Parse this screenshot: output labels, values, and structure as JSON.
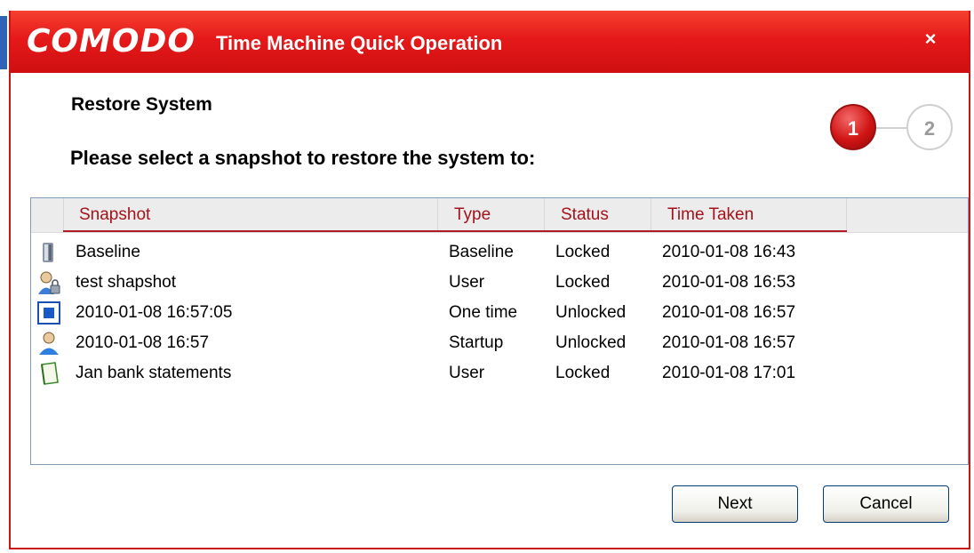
{
  "window": {
    "brand": "COMODO",
    "title": "Time Machine Quick Operation",
    "close_label": "×"
  },
  "heading": "Restore System",
  "prompt": "Please select a snapshot to restore the system to:",
  "steps": [
    "1",
    "2"
  ],
  "table": {
    "columns": [
      "Snapshot",
      "Type",
      "Status",
      "Time Taken"
    ],
    "rows": [
      {
        "icon": "baseline-icon",
        "snapshot": "Baseline",
        "type": "Baseline",
        "status": "Locked",
        "time": "2010-01-08 16:43"
      },
      {
        "icon": "user-lock-icon",
        "snapshot": "test shapshot",
        "type": "User",
        "status": "Locked",
        "time": "2010-01-08 16:53"
      },
      {
        "icon": "one-time-icon",
        "snapshot": "2010-01-08 16:57:05",
        "type": "One time",
        "status": "Unlocked",
        "time": "2010-01-08 16:57"
      },
      {
        "icon": "startup-user-icon",
        "snapshot": "2010-01-08 16:57",
        "type": "Startup",
        "status": "Unlocked",
        "time": "2010-01-08 16:57"
      },
      {
        "icon": "document-icon",
        "snapshot": "Jan bank statements",
        "type": "User",
        "status": "Locked",
        "time": "2010-01-08 17:01"
      }
    ]
  },
  "buttons": {
    "next": "Next",
    "cancel": "Cancel"
  },
  "colors": {
    "titlebar": "#e5191a",
    "header_text": "#a4121b",
    "accent_blue": "#2f63b8"
  }
}
